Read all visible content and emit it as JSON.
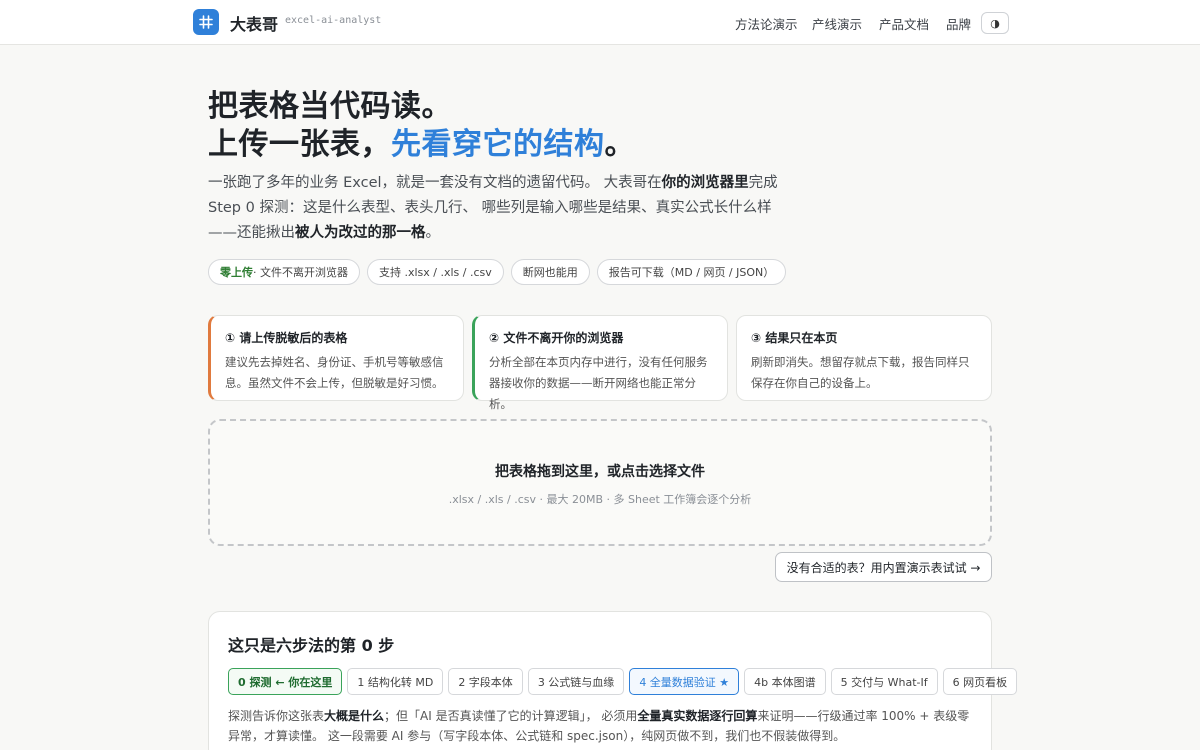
{
  "header": {
    "brand_name": "大表哥",
    "brand_slug": "excel-ai-analyst",
    "nav": [
      "方法论演示",
      "产线演示",
      "产品文档",
      "品牌"
    ],
    "theme_toggle": "◑"
  },
  "hero": {
    "title_line1": "把表格当代码读。",
    "title_line2_prefix": "上传一张表，",
    "title_line2_accent": "先看穿它的结构",
    "title_line2_suffix": "。",
    "desc_p1": "一张跑了多年的业务 Excel，就是一套没有文档的遗留代码。 大表哥在",
    "desc_b1": "你的浏览器里",
    "desc_p2": "完成 Step 0 探测：这是什么表型、表头几行、 哪些列是输入哪些是结果、真实公式长什么样——还能揪出",
    "desc_b2": "被人为改过的那一格",
    "desc_p3": "。",
    "chips": {
      "zero_upload_strong": "零上传",
      "zero_upload_rest": " · 文件不离开浏览器",
      "formats": "支持 .xlsx / .xls / .csv",
      "offline": "断网也能用",
      "download": "报告可下载（MD / 网页 / JSON）"
    }
  },
  "cards": [
    {
      "title": "① 请上传脱敏后的表格",
      "body": "建议先去掉姓名、身份证、手机号等敏感信息。虽然文件不会上传，但脱敏是好习惯。"
    },
    {
      "title": "② 文件不离开你的浏览器",
      "body": "分析全部在本页内存中进行，没有任何服务器接收你的数据——断开网络也能正常分析。"
    },
    {
      "title": "③ 结果只在本页",
      "body": "刷新即消失。想留存就点下载，报告同样只保存在你自己的设备上。"
    }
  ],
  "dropzone": {
    "title": "把表格拖到这里，或点击选择文件",
    "subtitle": ".xlsx / .xls / .csv · 最大 20MB · 多 Sheet 工作簿会逐个分析"
  },
  "demo_button": "没有合适的表？用内置演示表试试 →",
  "steps": {
    "title": "这只是六步法的第 0 步",
    "pills": [
      "0 探测 ← 你在这里",
      "1 结构化转 MD",
      "2 字段本体",
      "3 公式链与血缘",
      "4 全量数据验证 ★",
      "4b 本体图谱",
      "5 交付与 What-If",
      "6 网页看板"
    ],
    "desc_p1": "探测告诉你这张表",
    "desc_b1": "大概是什么",
    "desc_p2": "；但「AI 是否真读懂了它的计算逻辑」， 必须用",
    "desc_b2": "全量真实数据逐行回算",
    "desc_p3": "来证明——行级通过率 100% + 表级零异常，才算读懂。 这一段需要 AI 参与（写字段本体、公式链和 spec.json），纯网页做不到，我们也不假装做得到。"
  },
  "colors": {
    "accent": "#2f80d9",
    "green": "#3aa35a",
    "orange": "#e07a3e"
  }
}
